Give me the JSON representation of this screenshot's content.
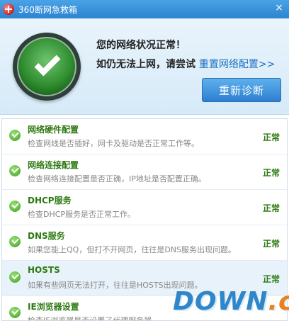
{
  "window": {
    "title": "360断网急救箱"
  },
  "titlebar": {
    "close_label": "×"
  },
  "header": {
    "status_title": "您的网络状况正常！",
    "hint_prefix": "如仍无法上网，请尝试",
    "reset_link": "重置网络配置>>",
    "rediag_button": "重新诊断"
  },
  "items": [
    {
      "name": "网络硬件配置",
      "desc": "检查网线是否插好，网卡及驱动是否正常工作等。",
      "state": "正常"
    },
    {
      "name": "网络连接配置",
      "desc": "检查网络连接配置是否正确，IP地址是否配置正确。",
      "state": "正常"
    },
    {
      "name": "DHCP服务",
      "desc": "检查DHCP服务是否正常工作。",
      "state": "正常"
    },
    {
      "name": "DNS服务",
      "desc": "如果您能上QQ，但打不开网页，往往是DNS服务出现问题。",
      "state": "正常"
    },
    {
      "name": "HOSTS",
      "desc": "如果有些网页无法打开，往往是HOSTS出现问题。",
      "state": "正常"
    },
    {
      "name": "IE浏览器设置",
      "desc": "检查IE浏览器是否设置了代理服务器。",
      "state": ""
    }
  ],
  "watermark": {
    "main": "DOWN",
    "suffix": ".cc"
  },
  "colors": {
    "accent": "#2c84d0",
    "ok_text": "#2e7a12",
    "link": "#1a6fc4"
  }
}
